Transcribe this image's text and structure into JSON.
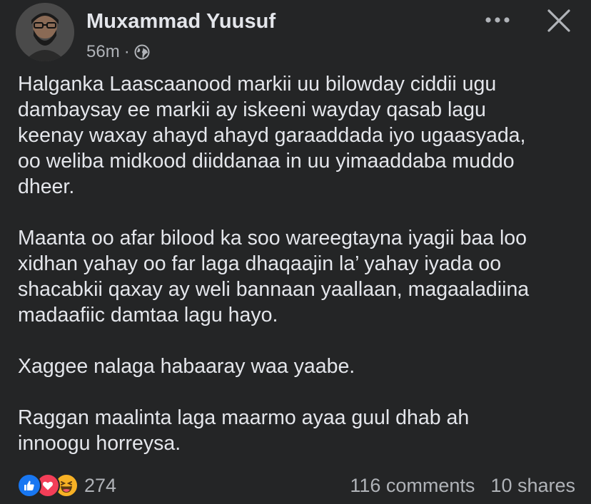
{
  "post": {
    "author": "Muxammad Yuusuf",
    "time": "56m",
    "separator": "·",
    "privacy_icon": "globe-icon",
    "paragraphs": [
      "Halganka Laascaanood markii uu bilowday ciddii ugu\ndambaysay ee markii ay iskeeni wayday qasab lagu\nkeenay waxay ahayd ahayd garaaddada iyo ugaasyada,\noo weliba midkood diiddanaa in uu yimaaddaba muddo\ndheer.",
      "Maanta oo afar bilood ka soo wareegtayna iyagii baa loo\nxidhan yahay oo far laga dhaqaajin la’ yahay iyada oo\nshacabkii qaxay ay weli bannaan yaallaan, magaaladiina\nmadaafiic damtaa lagu hayo.",
      "Xaggee nalaga habaaray waa yaabe.",
      "Raggan maalinta laga maarmo ayaa guul dhab ah\ninnoogu horreysa."
    ]
  },
  "actions": {
    "more_icon": "more-horizontal-icon",
    "close_icon": "close-icon"
  },
  "footer": {
    "reactions": [
      "like-icon",
      "love-icon",
      "haha-icon"
    ],
    "reaction_count": "274",
    "comments": "116 comments",
    "shares": "10 shares"
  },
  "colors": {
    "background": "#242526",
    "text": "#e4e6eb",
    "secondary_text": "#b0b3b8",
    "like": "#1877f2",
    "love": "#f33e58",
    "haha": "#f7b125"
  }
}
